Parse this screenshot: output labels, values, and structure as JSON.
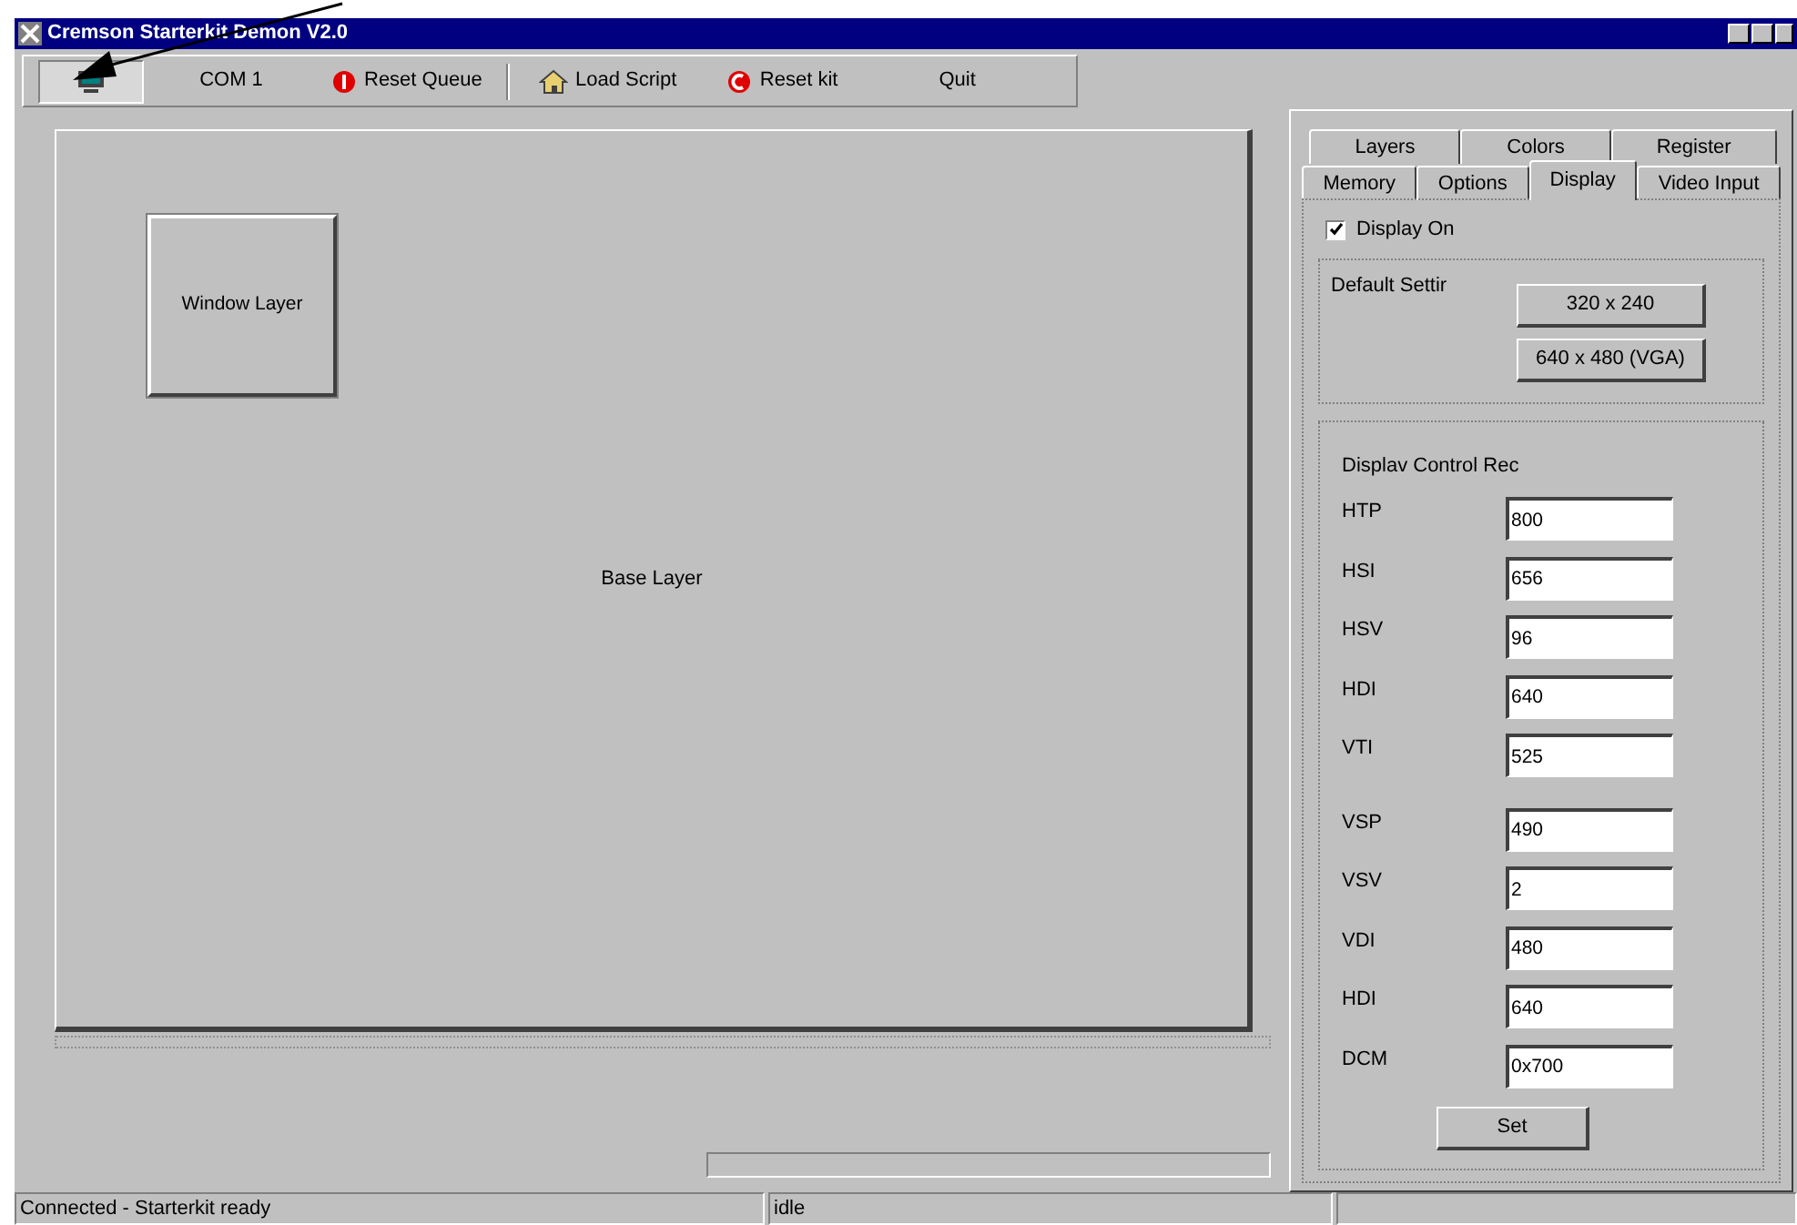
{
  "window": {
    "title": "Cremson Starterkit Demon V2.0"
  },
  "toolbar": [
    {
      "kind": "monitor",
      "pressed": true
    },
    {
      "kind": "text",
      "label": "COM 1",
      "pressed": false
    },
    {
      "kind": "stop",
      "label": "Reset Queue",
      "pressed": false
    },
    {
      "kind": "house",
      "label": "Load Script",
      "pressed": false
    },
    {
      "kind": "reset",
      "label": "Reset kit",
      "pressed": false
    },
    {
      "kind": "text",
      "label": "Quit",
      "pressed": false
    }
  ],
  "canvas": {
    "layers": [
      {
        "label": "Window Layer"
      }
    ],
    "base_label": "Base Layer"
  },
  "progress": {
    "level": 0
  },
  "tab_rows": [
    [
      {
        "label": "Layers",
        "selected": false
      },
      {
        "label": "Colors",
        "selected": false
      },
      {
        "label": "Register",
        "selected": false
      }
    ],
    [
      {
        "label": "Memory",
        "selected": false
      },
      {
        "label": "Options",
        "selected": false
      },
      {
        "label": "Display",
        "selected": true
      },
      {
        "label": "Video Input",
        "selected": false
      }
    ]
  ],
  "display_on": {
    "label": "Display On",
    "checked": true
  },
  "default_settings": {
    "label": "Default Settir",
    "buttons": [
      "320 x 240",
      "640 x 480 (VGA)"
    ]
  },
  "registers": {
    "label": "Displav Control Rec",
    "fields": [
      {
        "name": "HTP",
        "value": "800"
      },
      {
        "name": "HSI",
        "value": "656"
      },
      {
        "name": "HSV",
        "value": "96"
      },
      {
        "name": "HDI",
        "value": "640"
      },
      {
        "name": "VTI",
        "value": "525"
      },
      {
        "name": "VSP",
        "value": "490"
      },
      {
        "name": "VSV",
        "value": "2"
      },
      {
        "name": "VDI",
        "value": "480"
      },
      {
        "name": "HDI",
        "value": "640"
      },
      {
        "name": "DCM",
        "value": "0x700"
      }
    ],
    "button": "Set"
  },
  "status_bar": [
    "Connected - Starterkit ready",
    "idle"
  ]
}
